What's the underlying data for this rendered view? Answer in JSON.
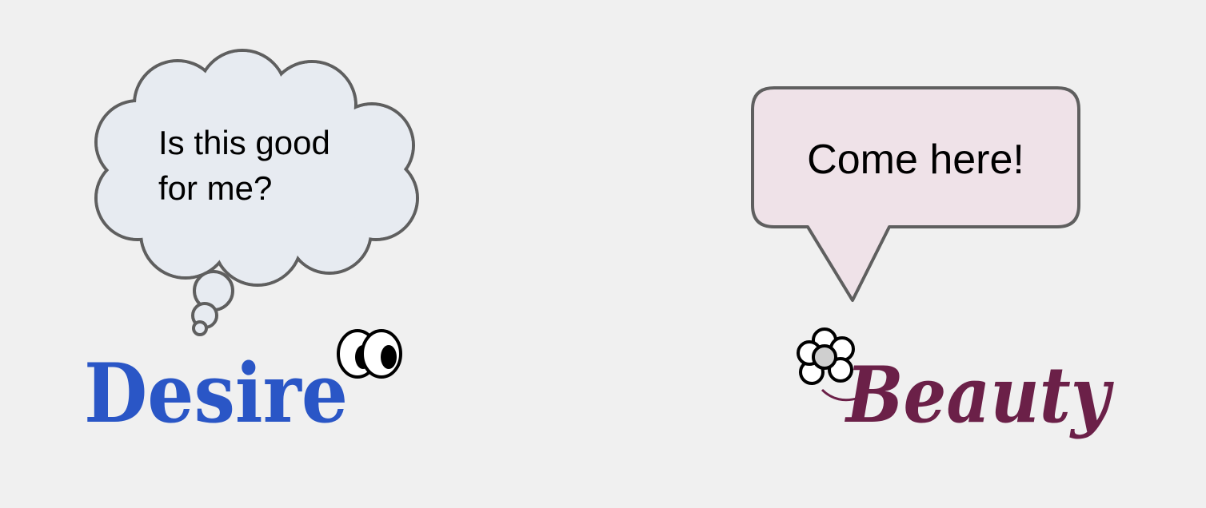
{
  "thought_bubble": {
    "line1": "Is this good",
    "line2": "for me?"
  },
  "speech_bubble": {
    "text": "Come here!"
  },
  "desire_label": {
    "text": "Desire"
  },
  "beauty_label": {
    "text": "Beauty"
  },
  "colors": {
    "background": "#f0f0f0",
    "thought_fill": "#e7ebf1",
    "speech_fill": "#efe2e8",
    "bubble_stroke": "#5f5f5f",
    "desire": "#2a56c6",
    "beauty": "#6b2048"
  }
}
